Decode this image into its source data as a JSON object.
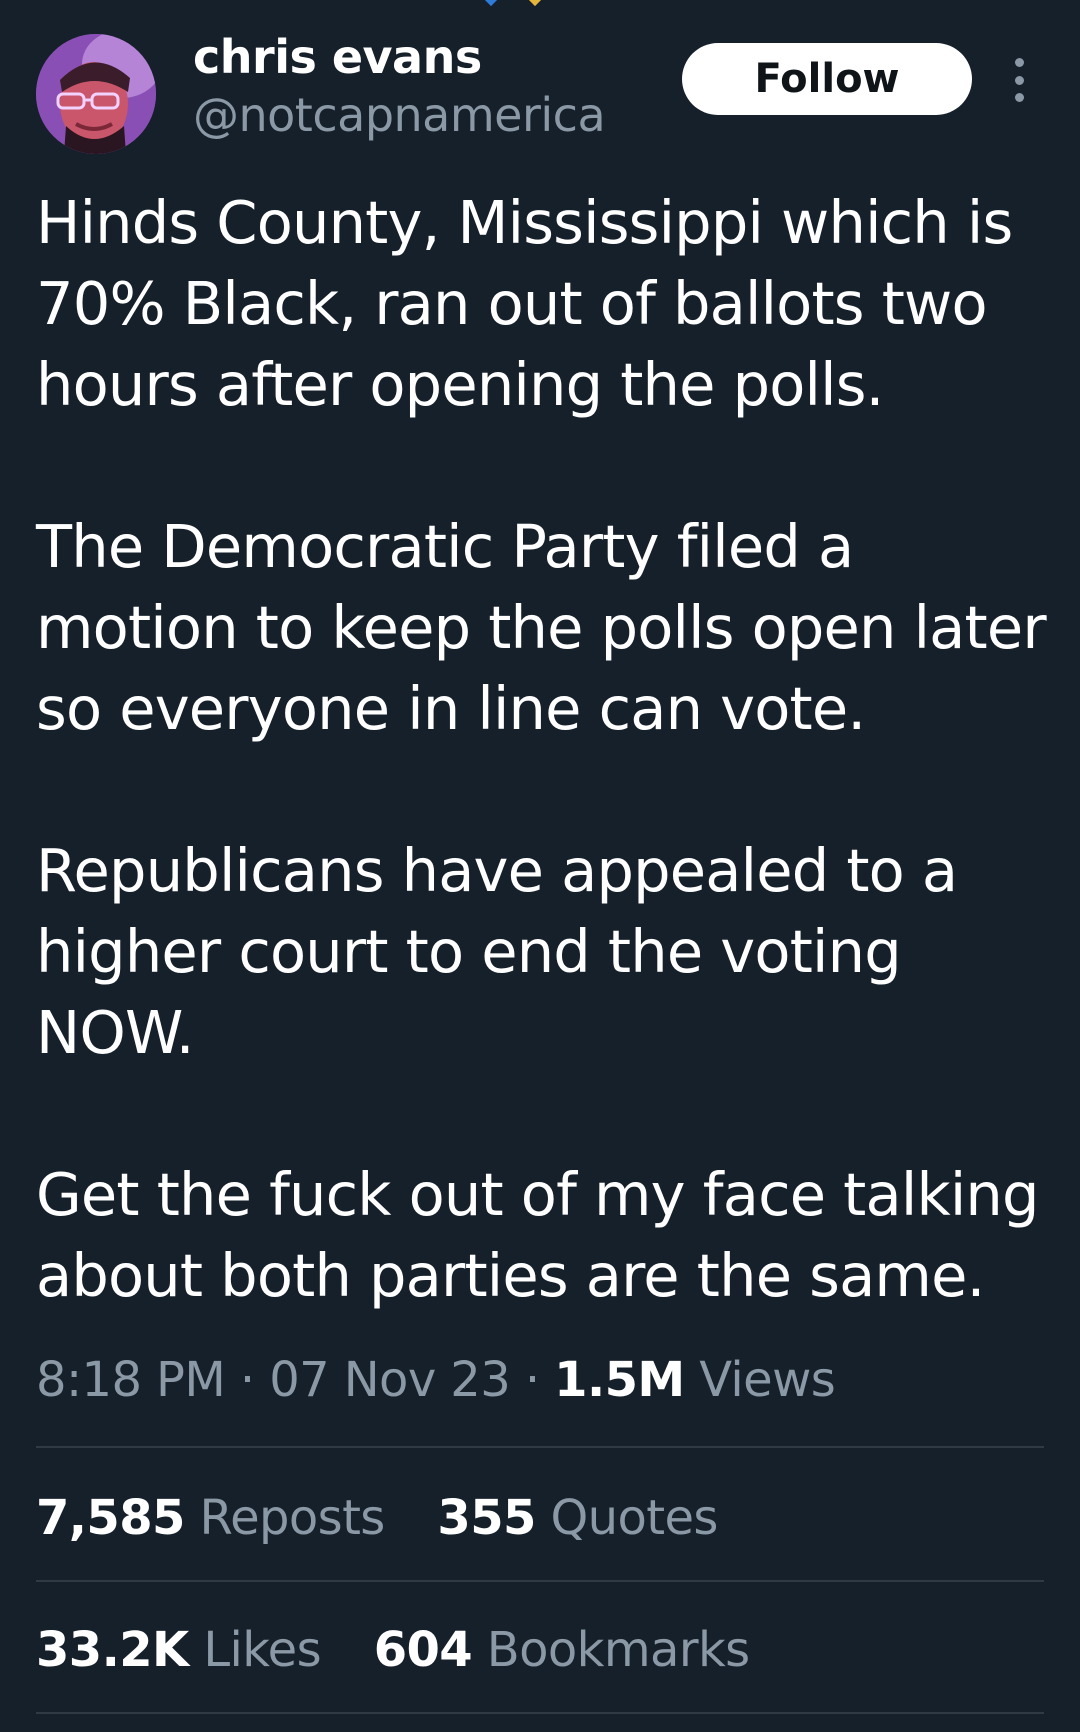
{
  "author": {
    "name": "chris evans",
    "handle": "@notcapnamerica"
  },
  "follow_label": "Follow",
  "tweet": {
    "paragraphs": [
      "Hinds County, Mississippi which is 70% Black, ran out of ballots two hours after opening the polls.",
      "The Democratic Party filed a motion to keep the polls open later so everyone in line can vote.",
      "Republicans have appealed to a higher court to end the voting NOW.",
      "Get the fuck out of my face talking about both parties are the same."
    ]
  },
  "meta": {
    "time": "8:18 PM",
    "sep": " · ",
    "date": "07 Nov 23",
    "views_count": "1.5M",
    "views_label": "Views"
  },
  "stats": {
    "reposts_count": "7,585",
    "reposts_label": "Reposts",
    "quotes_count": "355",
    "quotes_label": "Quotes",
    "likes_count": "33.2K",
    "likes_label": "Likes",
    "bookmarks_count": "604",
    "bookmarks_label": "Bookmarks"
  },
  "icons": {
    "more": "more-vertical-icon"
  },
  "colors": {
    "background": "#16202a",
    "text_primary": "#ffffff",
    "text_secondary": "#8b98a5",
    "divider": "#2f3a45"
  }
}
